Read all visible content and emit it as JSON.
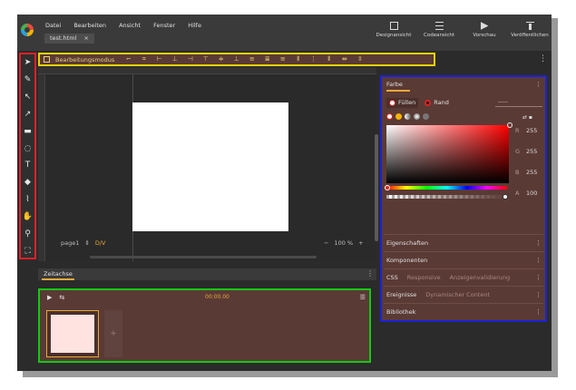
{
  "menu": [
    "Datei",
    "Bearbeiten",
    "Ansicht",
    "Fenster",
    "Hilfe"
  ],
  "file_tab": {
    "name": "test.html",
    "close": "×"
  },
  "views": [
    {
      "label": "Designansicht",
      "icon": "design-view-icon"
    },
    {
      "label": "Codeansicht",
      "icon": "code-view-icon"
    },
    {
      "label": "Vorschau",
      "icon": "preview-icon"
    },
    {
      "label": "Veröffentlichen",
      "icon": "publish-icon"
    }
  ],
  "edit_toolbar": {
    "mode_label": "Bearbeitungsmodus"
  },
  "canvas": {
    "page_label": "page1",
    "page_arrows": "⇕",
    "device": "D/V",
    "zoom": "100 %",
    "zoom_minus": "−",
    "zoom_plus": "+"
  },
  "color_panel": {
    "title": "Farbe",
    "fill_label": "Füllen",
    "border_label": "Rand",
    "hex_value": "-----",
    "rgba": {
      "r_label": "R",
      "r": "255",
      "g_label": "G",
      "g": "255",
      "b_label": "B",
      "b": "255",
      "a_label": "A",
      "a": "100"
    }
  },
  "sections": [
    {
      "label": "Eigenschaften"
    },
    {
      "label": "Komponenten"
    },
    {
      "label": "CSS",
      "sub1": "Responsive",
      "sub2": "Anzeigenvalidierung"
    },
    {
      "label": "Ereignisse",
      "sub1": "Dynamischer Content"
    },
    {
      "label": "Bibliothek"
    }
  ],
  "timeline": {
    "title": "Zeitachse",
    "time": "00:00.00"
  },
  "colors": {
    "accent": "#e6a93a",
    "panel_bg": "#5a3a35",
    "red_outline": "#e0202a",
    "yellow_outline": "#e6d200",
    "blue_outline": "#1b22d8",
    "green_outline": "#14c814"
  }
}
